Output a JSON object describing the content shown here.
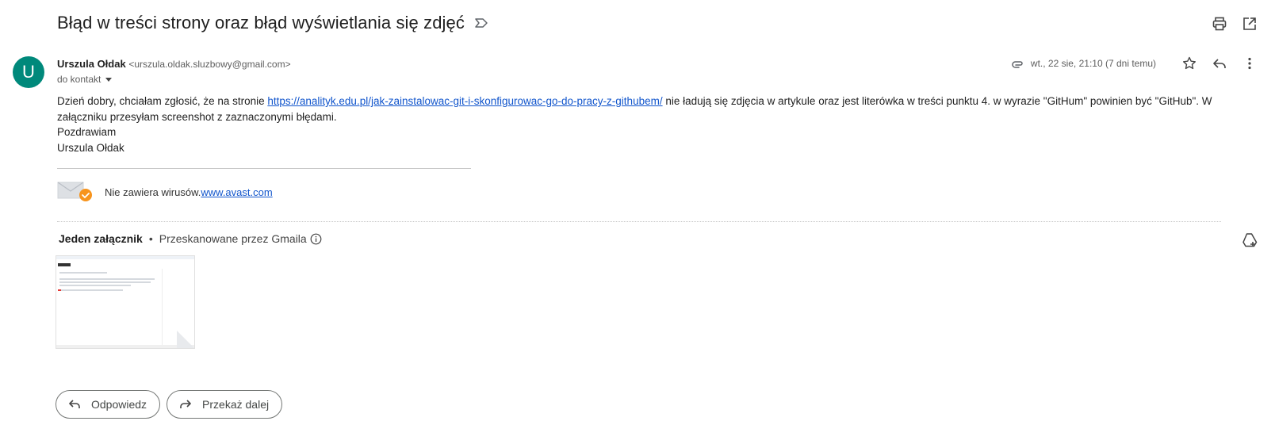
{
  "subject": "Błąd w treści strony oraz błąd wyświetlania się zdjęć",
  "sender": {
    "avatar_letter": "U",
    "name": "Urszula Ołdak",
    "email": "<urszula.oldak.sluzbowy@gmail.com>",
    "to": "do kontakt",
    "date": "wt., 22 sie, 21:10 (7 dni temu)"
  },
  "body": {
    "line1_prefix": "Dzień dobry, chciałam zgłosić, że na stronie ",
    "link": "https://analityk.edu.pl/jak-zainstalowac-git-i-skonfigurowac-go-do-pracy-z-githubem/",
    "line1_suffix": " nie ładują się zdjęcia w artykule oraz jest literówka w treści punktu 4. w wyrazie \"GitHum\" powinien być \"GitHub\". W załączniku przesyłam screenshot z zaznaczonymi błędami.",
    "greeting": "Pozdrawiam",
    "signature": "Urszula Ołdak"
  },
  "avast": {
    "text": "Nie zawiera wirusów.",
    "link": "www.avast.com"
  },
  "attachments": {
    "count_label": "Jeden załącznik",
    "separator": "•",
    "scanned_label": "Przeskanowane przez Gmaila"
  },
  "buttons": {
    "reply": "Odpowiedz",
    "forward": "Przekaż dalej"
  },
  "colors": {
    "avatar": "#00897b",
    "link": "#1155cc",
    "avast_check": "#f7941d"
  }
}
